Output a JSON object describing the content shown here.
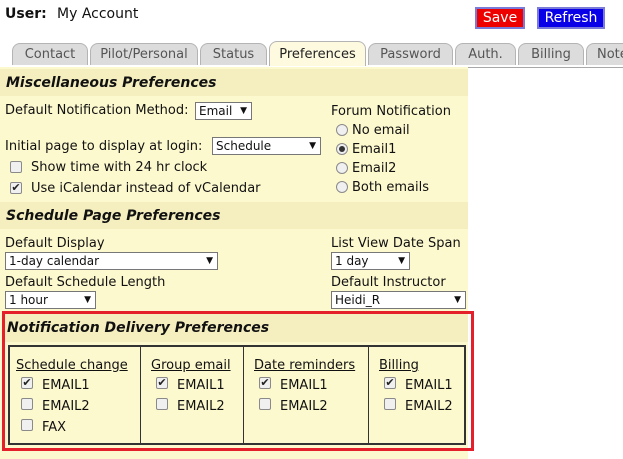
{
  "header": {
    "user_label": "User:",
    "user_value": "My Account"
  },
  "actions": {
    "save_label": "Save",
    "refresh_label": "Refresh"
  },
  "tabs": [
    {
      "label": "Contact"
    },
    {
      "label": "Pilot/Personal"
    },
    {
      "label": "Status"
    },
    {
      "label": "Preferences",
      "active": true
    },
    {
      "label": "Password"
    },
    {
      "label": "Auth."
    },
    {
      "label": "Billing"
    },
    {
      "label": "Note"
    }
  ],
  "misc": {
    "title": "Miscellaneous Preferences",
    "notification_method_label": "Default Notification Method:",
    "notification_method_value": "Email",
    "initial_page_label": "Initial page to display at login:",
    "initial_page_value": "Schedule",
    "time24_label": "Show time with 24 hr clock",
    "time24_checked": false,
    "icalendar_label": "Use iCalendar instead of vCalendar",
    "icalendar_checked": true,
    "forum": {
      "title": "Forum Notification",
      "options": [
        {
          "label": "No email",
          "selected": false
        },
        {
          "label": "Email1",
          "selected": true
        },
        {
          "label": "Email2",
          "selected": false
        },
        {
          "label": "Both emails",
          "selected": false
        }
      ]
    }
  },
  "schedule": {
    "title": "Schedule Page Preferences",
    "default_display_label": "Default Display",
    "default_display_value": "1-day calendar",
    "list_span_label": "List View Date Span",
    "list_span_value": "1 day",
    "schedule_length_label": "Default Schedule Length",
    "schedule_length_value": "1 hour",
    "instructor_label": "Default Instructor",
    "instructor_value": "Heidi_R"
  },
  "notification": {
    "title": "Notification Delivery Preferences",
    "columns": [
      {
        "header": "Schedule change",
        "items": [
          {
            "label": "EMAIL1",
            "checked": true
          },
          {
            "label": "EMAIL2",
            "checked": false
          },
          {
            "label": "FAX",
            "checked": false
          }
        ]
      },
      {
        "header": "Group email",
        "items": [
          {
            "label": "EMAIL1",
            "checked": true
          },
          {
            "label": "EMAIL2",
            "checked": false
          }
        ]
      },
      {
        "header": "Date reminders",
        "items": [
          {
            "label": "EMAIL1",
            "checked": true
          },
          {
            "label": "EMAIL2",
            "checked": false
          }
        ]
      },
      {
        "header": "Billing",
        "items": [
          {
            "label": "EMAIL1",
            "checked": true
          },
          {
            "label": "EMAIL2",
            "checked": false
          }
        ]
      }
    ]
  },
  "colors": {
    "save": "#ee0000",
    "refresh": "#0a00e8",
    "panel": "#fdf9cf",
    "section": "#f5efbf",
    "highlight": "#e4212b"
  }
}
